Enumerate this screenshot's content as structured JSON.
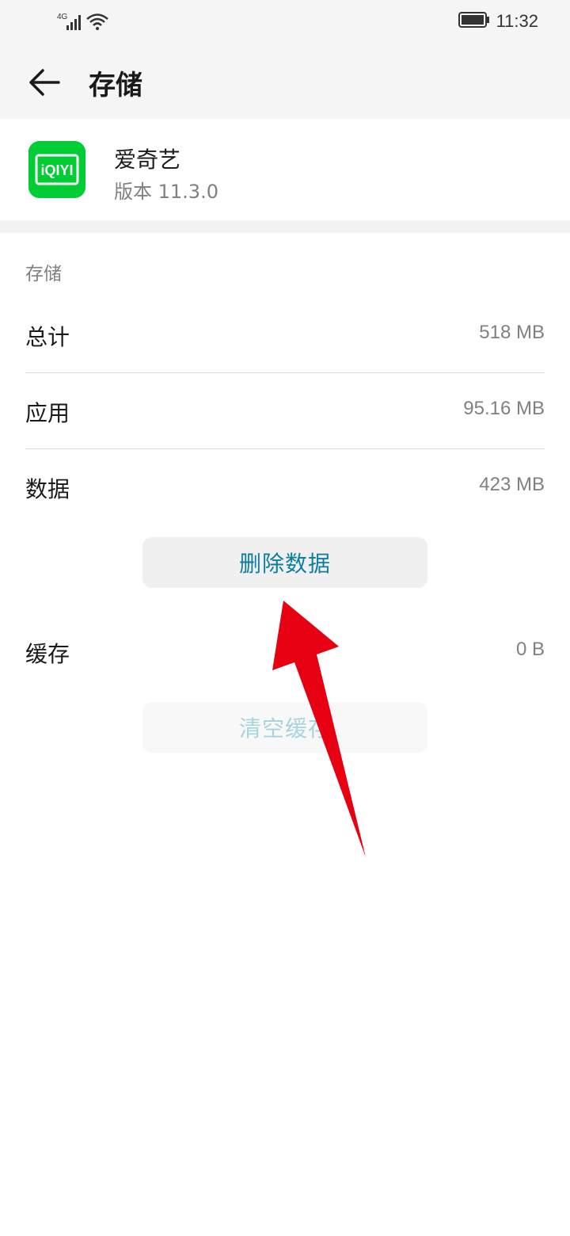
{
  "status_bar": {
    "network": "4G",
    "time": "11:32"
  },
  "header": {
    "title": "存储",
    "back_icon": "arrow-left-icon"
  },
  "app": {
    "name": "爱奇艺",
    "version": "版本 11.3.0",
    "icon_text": "iQIYI",
    "icon_color": "#00cc33"
  },
  "storage": {
    "section_title": "存储",
    "rows": [
      {
        "label": "总计",
        "value": "518 MB"
      },
      {
        "label": "应用",
        "value": "95.16 MB"
      },
      {
        "label": "数据",
        "value": "423 MB"
      },
      {
        "label": "缓存",
        "value": "0 B"
      }
    ],
    "delete_data_label": "删除数据",
    "clear_cache_label": "清空缓存"
  },
  "colors": {
    "accent": "#0c7e9e",
    "disabled_accent": "#a9d4df",
    "annotation_arrow": "#e60012"
  }
}
